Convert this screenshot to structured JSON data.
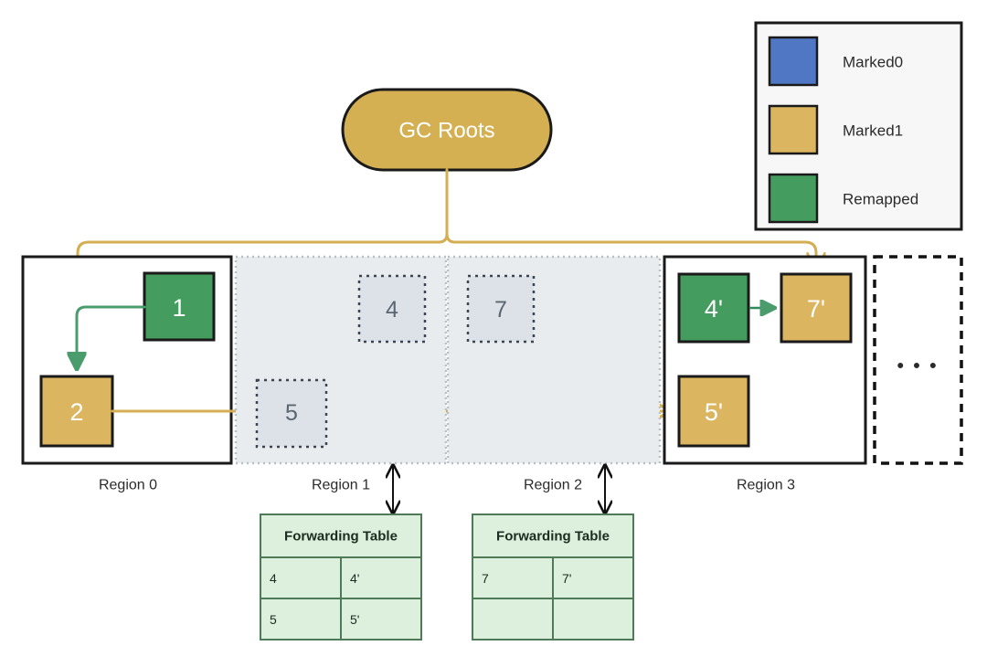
{
  "legend": {
    "title": "legend",
    "items": [
      {
        "label": "Marked0",
        "color": "#4f77c4",
        "swatch_name": "legend-swatch-marked0"
      },
      {
        "label": "Marked1",
        "color": "#dbb55f",
        "swatch_name": "legend-swatch-marked1"
      },
      {
        "label": "Remapped",
        "color": "#449c5e",
        "swatch_name": "legend-swatch-remapped"
      }
    ]
  },
  "roots": {
    "label": "GC Roots",
    "color": "#d4b053"
  },
  "colors": {
    "marked0": "#4f77c4",
    "marked1": "#dbb55f",
    "remapped": "#449c5e",
    "gold_edge": "#d4ae52",
    "green_edge": "#4b9c6d",
    "relocated_fill": "#e9ecef",
    "ghost_fill": "#dde2e9",
    "ghost_stroke": "#3c4450",
    "table_fill": "#ddf0de",
    "table_stroke": "#4f7a58",
    "outline": "#1a1a1a"
  },
  "regions": [
    {
      "label": "Region 0",
      "state": "active",
      "objects": [
        {
          "id": "1",
          "color_role": "remapped"
        },
        {
          "id": "2",
          "color_role": "marked1"
        }
      ]
    },
    {
      "label": "Region 1",
      "state": "relocated",
      "objects": [
        {
          "id": "4",
          "color_role": "ghost"
        },
        {
          "id": "5",
          "color_role": "ghost"
        }
      ]
    },
    {
      "label": "Region 2",
      "state": "relocated",
      "objects": [
        {
          "id": "7",
          "color_role": "ghost"
        }
      ]
    },
    {
      "label": "Region 3",
      "state": "active",
      "objects": [
        {
          "id": "4'",
          "color_role": "remapped"
        },
        {
          "id": "7'",
          "color_role": "marked1"
        },
        {
          "id": "5'",
          "color_role": "marked1"
        }
      ]
    }
  ],
  "more_regions": {
    "ellipsis": "• • •"
  },
  "forwarding_tables": [
    {
      "title": "Forwarding Table",
      "source_region": "Region 1",
      "rows": [
        {
          "from": "4",
          "to": "4'"
        },
        {
          "from": "5",
          "to": "5'"
        }
      ]
    },
    {
      "title": "Forwarding Table",
      "source_region": "Region 2",
      "rows": [
        {
          "from": "7",
          "to": "7'"
        },
        {
          "from": "",
          "to": ""
        }
      ]
    }
  ],
  "edges": [
    {
      "name": "root-to-object-2",
      "from": "GC Roots",
      "to": "2",
      "color_role": "marked1"
    },
    {
      "name": "root-to-object-7prime",
      "from": "GC Roots",
      "to": "7'",
      "color_role": "marked1"
    },
    {
      "name": "object-1-to-object-2",
      "from": "1",
      "to": "2",
      "color_role": "remapped"
    },
    {
      "name": "object-2-to-object-5prime",
      "from": "2",
      "to": "5'",
      "color_role": "marked1"
    },
    {
      "name": "object-4prime-to-object-7prime",
      "from": "4'",
      "to": "7'",
      "color_role": "remapped"
    }
  ]
}
